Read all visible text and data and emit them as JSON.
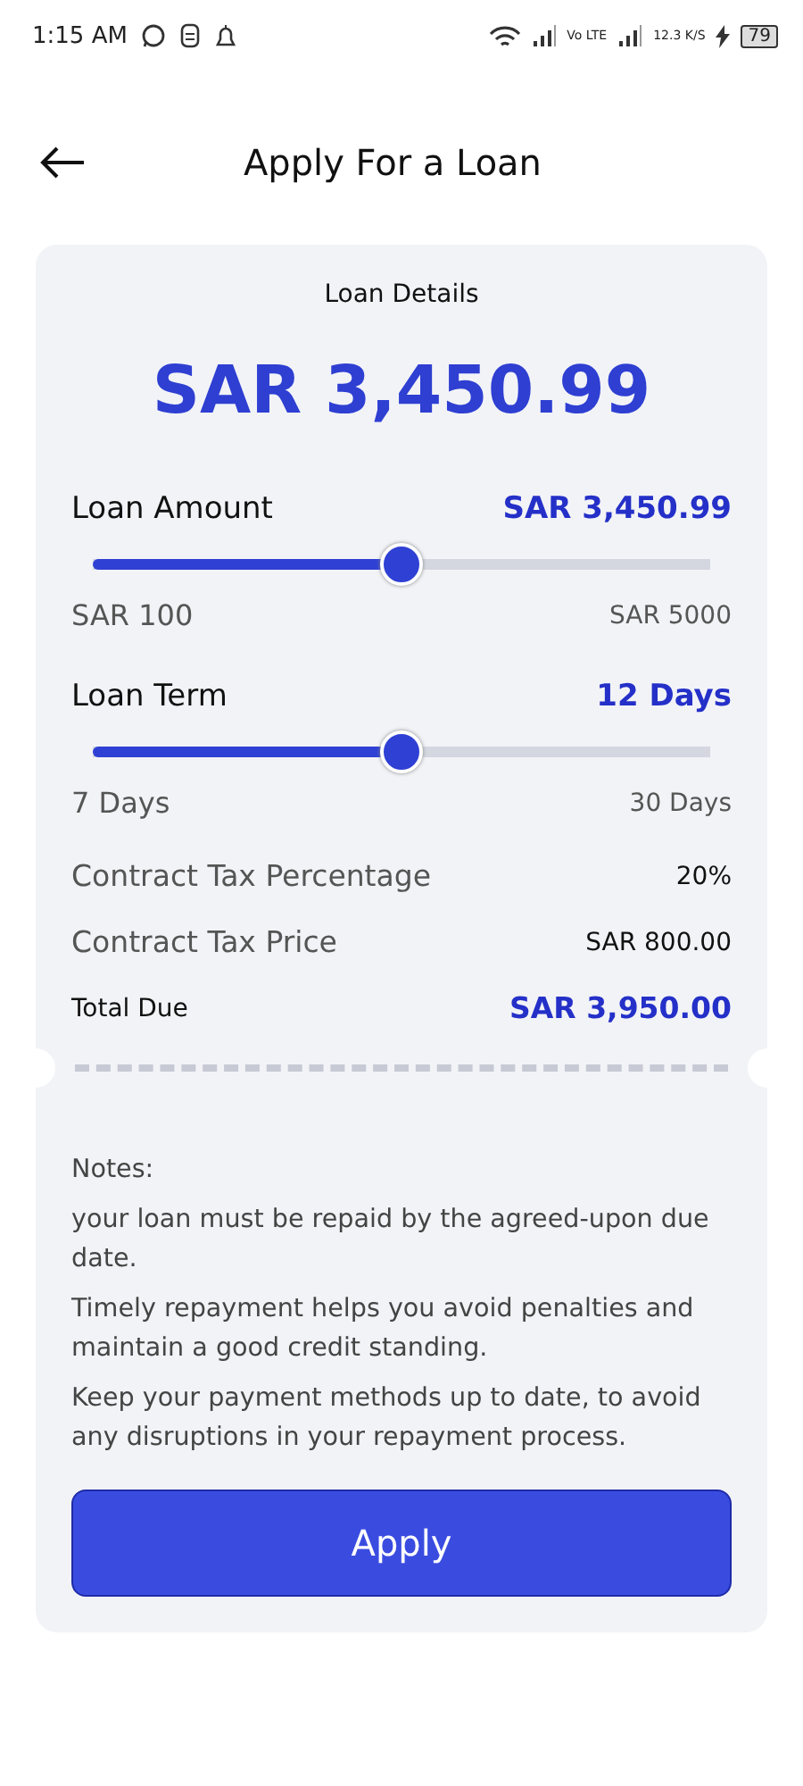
{
  "status_bar": {
    "time": "1:15 AM",
    "network_type": "Vo LTE",
    "speed": "12.3 K/S",
    "battery": "79"
  },
  "header": {
    "title": "Apply For a Loan"
  },
  "card": {
    "heading": "Loan Details",
    "amount": "SAR 3,450.99",
    "sliders": [
      {
        "label": "Loan Amount",
        "value": "SAR 3,450.99",
        "level": 0.5,
        "min": "SAR 100",
        "max": "SAR 5000"
      },
      {
        "label": "Loan Term",
        "value": "12 Days",
        "level": 0.5,
        "min": "7 Days",
        "max": "30 Days"
      }
    ],
    "summary": [
      {
        "kind": "info",
        "label": "Contract Tax Percentage",
        "value": "20%"
      },
      {
        "kind": "info",
        "label": "Contract Tax Price",
        "value": "SAR 800.00"
      },
      {
        "kind": "total",
        "label": "Total Due",
        "value": "SAR 3,950.00"
      }
    ],
    "notes_title": "Notes:",
    "notes": [
      "your loan must be repaid by the agreed-upon due date.",
      "Timely repayment helps you avoid penalties and maintain a good credit standing.",
      "Keep your payment methods up to date, to avoid any disruptions in your repayment process."
    ],
    "button": "Apply"
  }
}
